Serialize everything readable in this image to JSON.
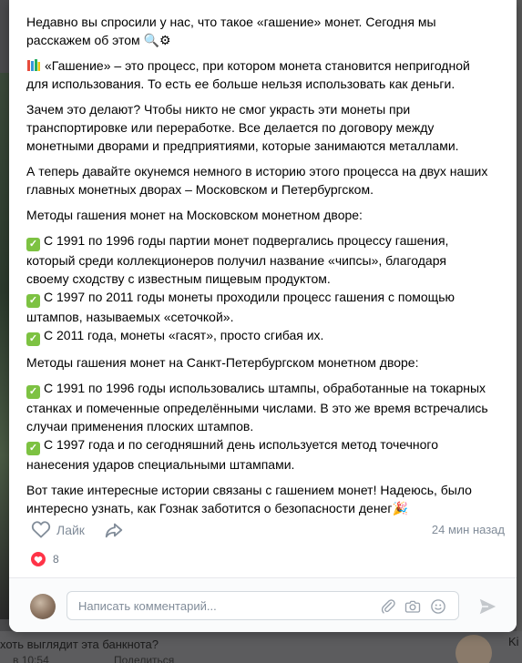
{
  "background": {
    "snippet_question": "хоть выглядит эта банкнота?",
    "snippet_time": "в 10:54",
    "snippet_share": "Поделиться",
    "snippet_right": "Ki"
  },
  "post": {
    "paragraphs": [
      [
        "Недавно вы спросили у нас, что такое «гашение» монет. Сегодня мы",
        "расскажем об этом 🔍⚙"
      ],
      [
        "«Гашение» – это процесс, при котором монета становится непригодной",
        "для использования. То есть ее больше нельзя использовать как деньги."
      ],
      [
        "Зачем это делают? Чтобы никто не смог украсть эти монеты при",
        "транспортировке или переработке. Все делается по договору между",
        "монетными дворами и предприятиями, которые занимаются металлами."
      ],
      [
        "А теперь давайте окунемся немного в историю этого процесса на двух наших",
        "главных монетных дворах – Московском и Петербургском."
      ],
      [
        "Методы гашения монет на Московском монетном дворе:"
      ],
      [
        "С 1991 по 1996 годы партии монет подвергались процессу гашения,",
        "который среди коллекционеров получил название «чипсы», благодаря",
        "своему сходству с известным пищевым продуктом.",
        "С 1997 по 2011 годы монеты проходили процесс гашения с помощью",
        "штампов, называемых «сеточкой».",
        "С 2011 года, монеты «гасят», просто сгибая их."
      ],
      [
        "Методы гашения монет на Санкт-Петербургском монетном дворе:"
      ],
      [
        "С 1991 по 1996 годы использовались штампы, обработанные на токарных",
        "станках и помеченные определёнными числами. В это же время встречались",
        "случаи применения плоских штампов.",
        "С 1997 года и по сегодняшний день используется метод точечного",
        "нанесения ударов специальными штампами."
      ],
      [
        "Вот такие интересные истории связаны с гашением монет! Надеюсь, было",
        "интересно узнать, как Гознак заботится о безопасности денег🎉"
      ]
    ]
  },
  "actions": {
    "like_label": "Лайк",
    "time": "24 мин назад",
    "reaction_count": "8"
  },
  "comment": {
    "placeholder": "Написать комментарий..."
  },
  "colors": {
    "check_green": "#7dc242",
    "heart_red": "#ff3347",
    "muted": "#818c99"
  }
}
